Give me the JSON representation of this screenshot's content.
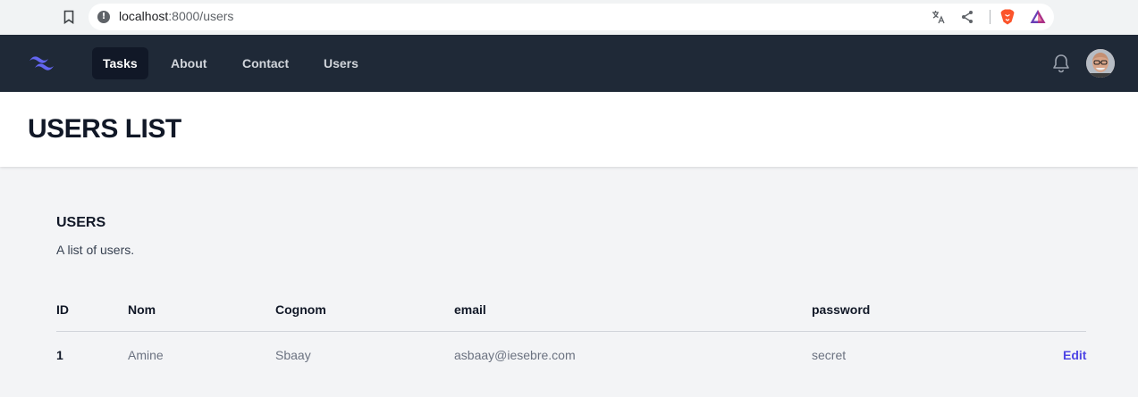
{
  "browser": {
    "url_host": "localhost",
    "url_path": ":8000/users",
    "icons": [
      "bookmark-icon",
      "info-icon",
      "translate-icon",
      "share-icon",
      "brave-icon",
      "rewards-icon"
    ]
  },
  "nav": {
    "items": [
      {
        "label": "Tasks",
        "active": true
      },
      {
        "label": "About",
        "active": false
      },
      {
        "label": "Contact",
        "active": false
      },
      {
        "label": "Users",
        "active": false
      }
    ],
    "accent_color": "#6366f1",
    "background_color": "#1f2937"
  },
  "header": {
    "title": "USERS LIST"
  },
  "users_section": {
    "title": "USERS",
    "description": "A list of users."
  },
  "table": {
    "columns": [
      "ID",
      "Nom",
      "Cognom",
      "email",
      "password"
    ],
    "rows": [
      {
        "id": "1",
        "nom": "Amine",
        "cognom": "Sbaay",
        "email": "asbaay@iesebre.com",
        "password": "secret",
        "action": "Edit"
      }
    ]
  }
}
